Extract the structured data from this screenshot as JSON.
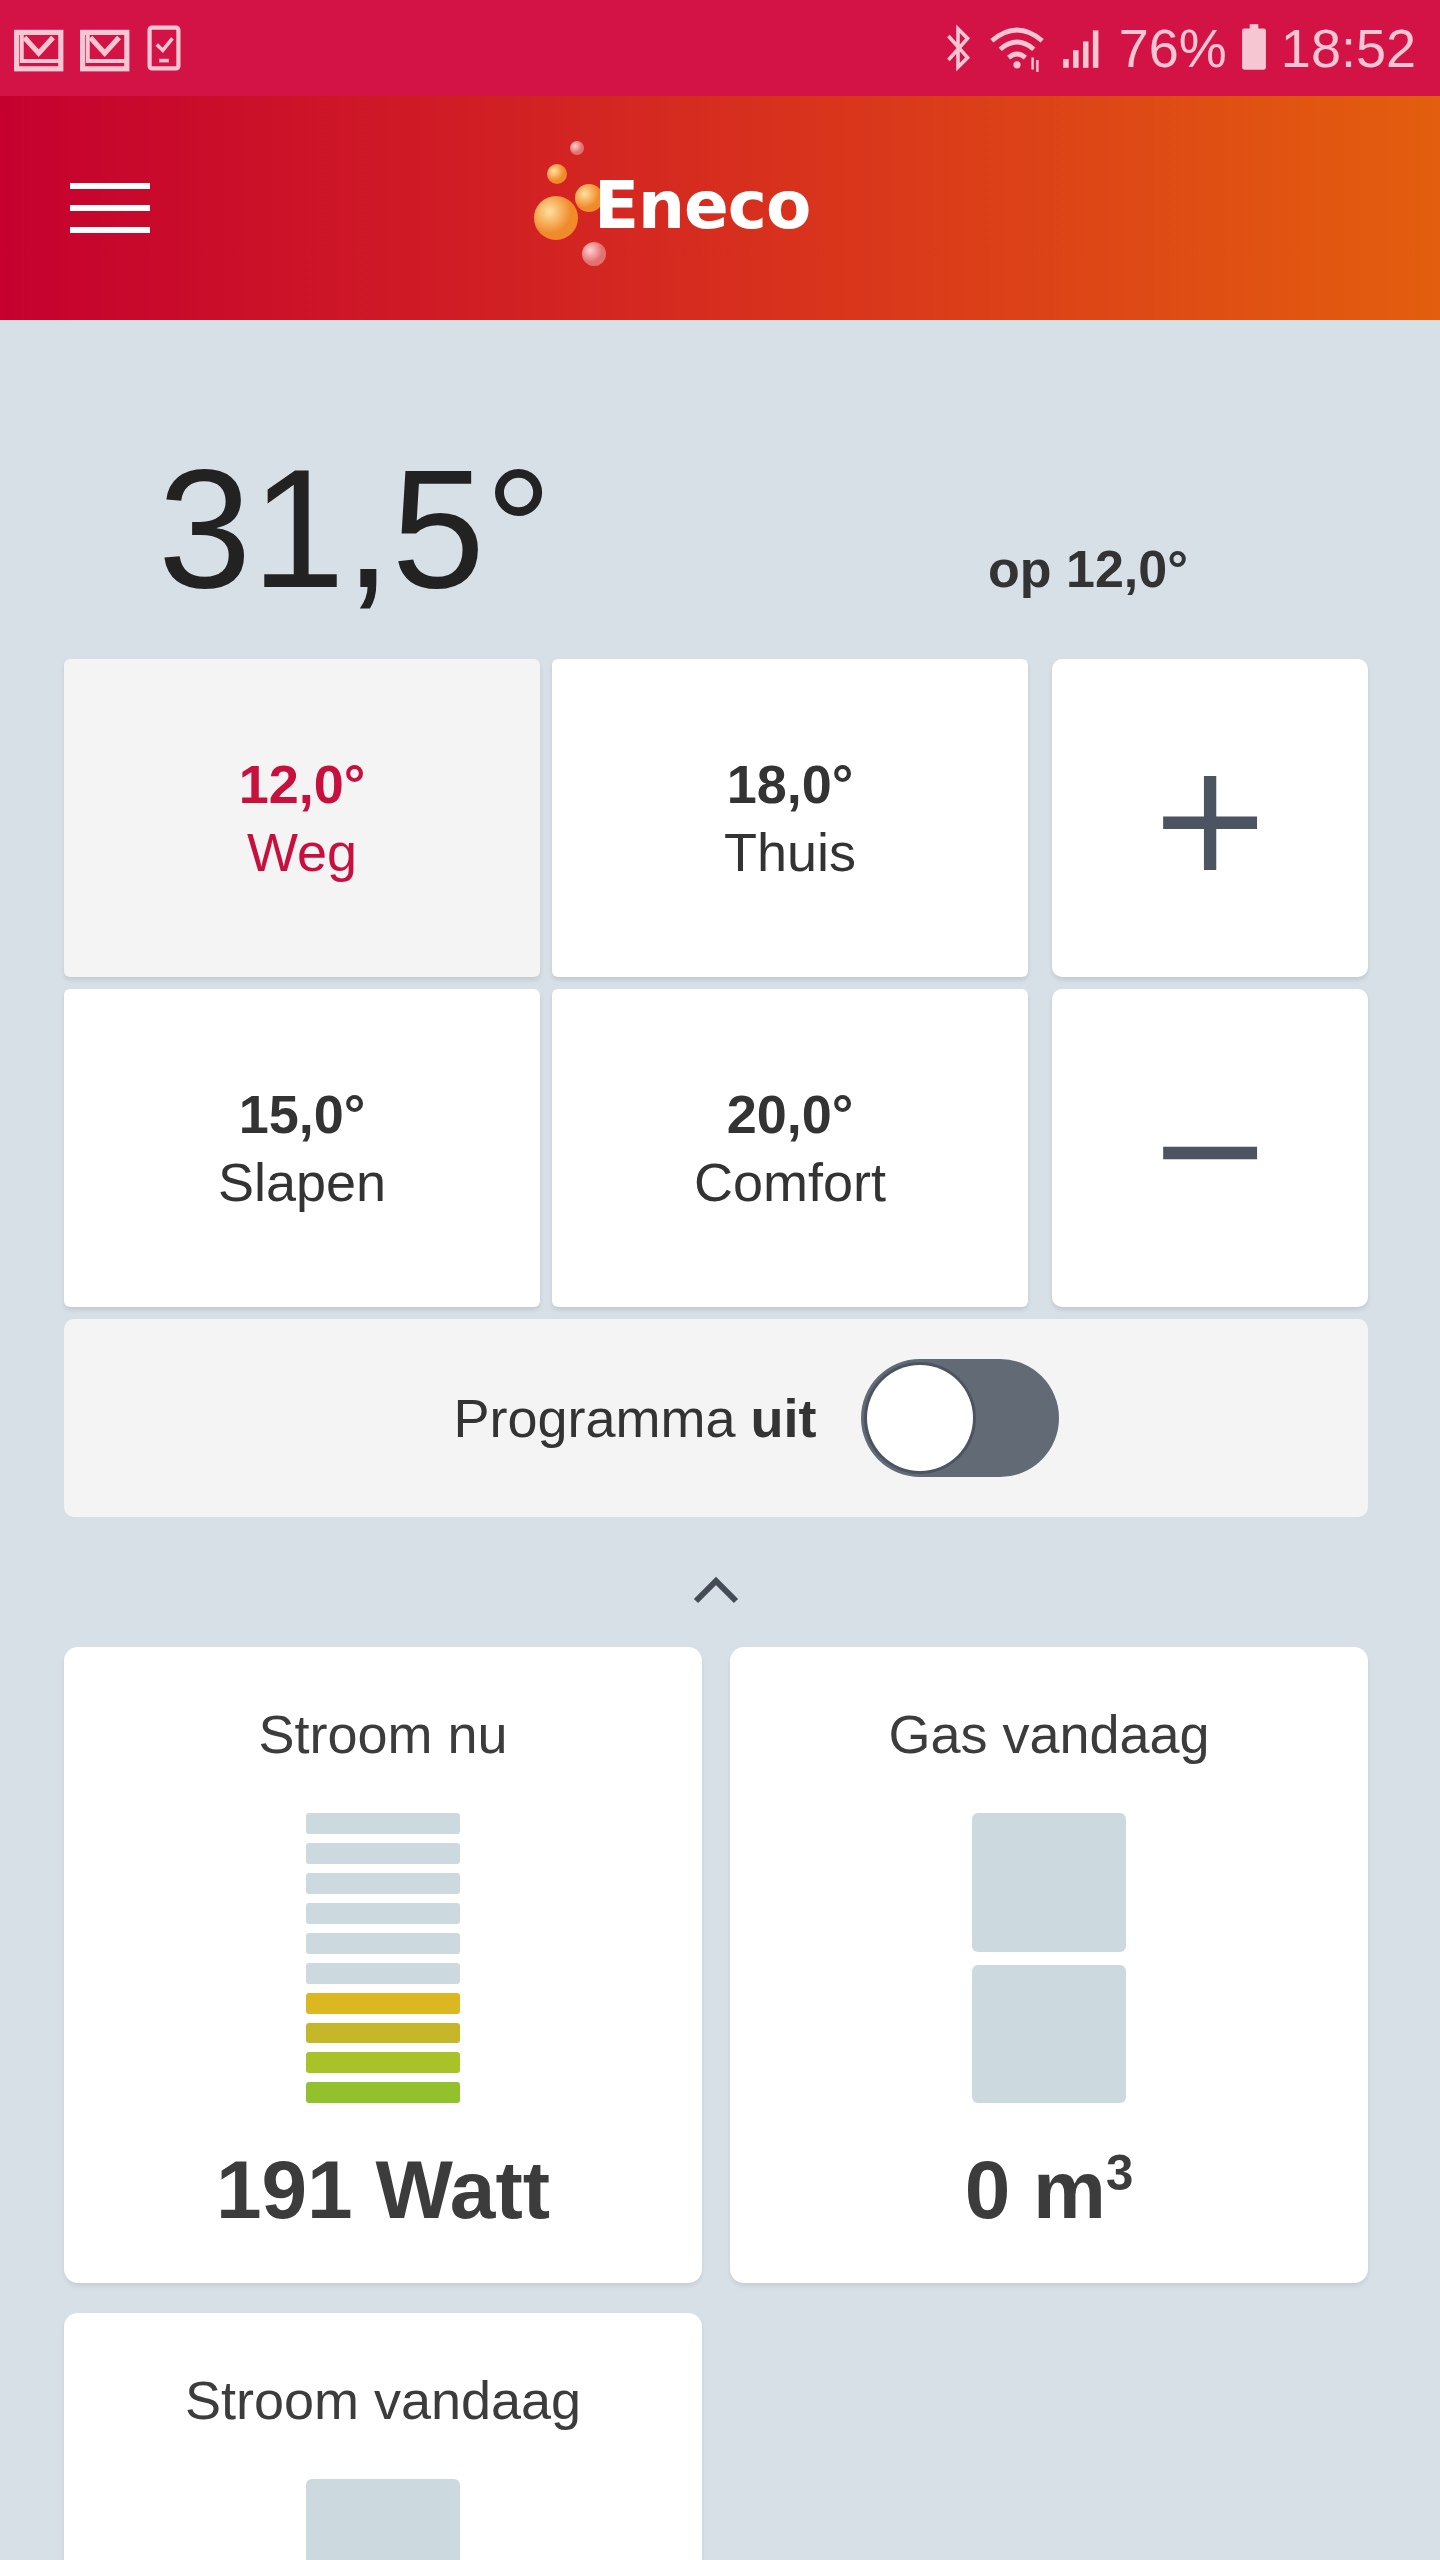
{
  "status_bar": {
    "battery": "76%",
    "time": "18:52"
  },
  "header": {
    "logo": "Eneco"
  },
  "current": {
    "temperature": "31,5°",
    "setpoint": "op 12,0°"
  },
  "presets": [
    {
      "temperature": "12,0°",
      "label": "Weg",
      "selected": true
    },
    {
      "temperature": "18,0°",
      "label": "Thuis",
      "selected": false
    },
    {
      "temperature": "15,0°",
      "label": "Slapen",
      "selected": false
    },
    {
      "temperature": "20,0°",
      "label": "Comfort",
      "selected": false
    }
  ],
  "adjust": {
    "plus": "+",
    "minus": "−"
  },
  "program": {
    "label": "Programma **uit**",
    "on": false
  },
  "cards": [
    {
      "title": "Stroom nu",
      "kind": "bars",
      "level": 0.4,
      "value": "191 Watt"
    },
    {
      "title": "Gas vandaag",
      "kind": "blocks",
      "value": "0 m$^{3}$"
    },
    {
      "title": "Stroom vandaag",
      "kind": "blocks"
    }
  ]
}
